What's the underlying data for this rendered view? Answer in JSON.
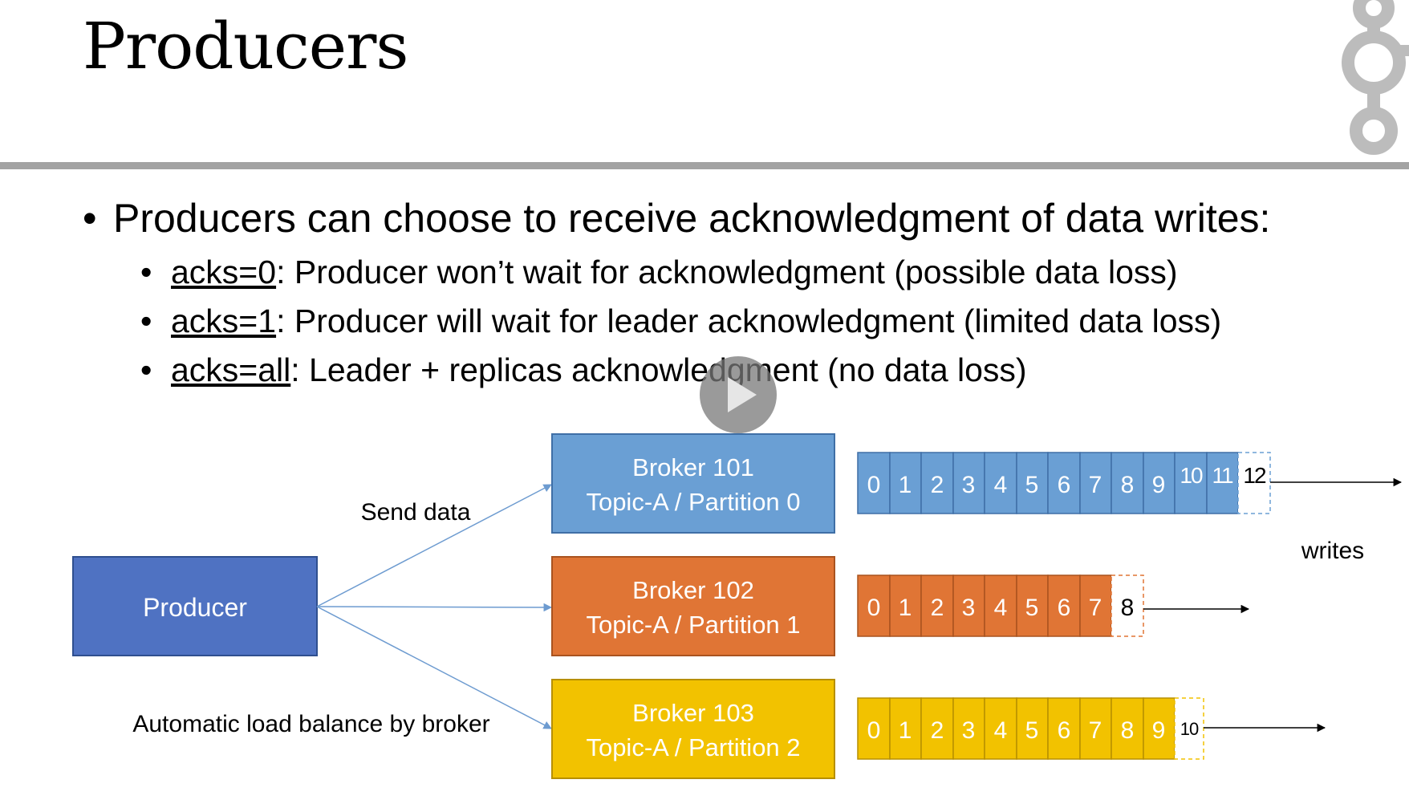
{
  "slide": {
    "title": "Producers",
    "bullet_main": "Producers can choose to receive acknowledgment of data writes:",
    "sub_bullets": [
      {
        "key": "acks=0",
        "text": ": Producer won’t wait for acknowledgment (possible data loss)"
      },
      {
        "key": "acks=1",
        "text": ": Producer will wait for leader acknowledgment (limited data loss)"
      },
      {
        "key": "acks=all",
        "text": ": Leader + replicas acknowledgment (no data loss)"
      }
    ]
  },
  "diagram": {
    "producer_label": "Producer",
    "send_data_label": "Send data",
    "load_balance_label": "Automatic load balance by broker",
    "writes_label": "writes",
    "brokers": [
      {
        "line1": "Broker 101",
        "line2": "Topic-A / Partition 0",
        "color": "#6a9fd4",
        "cells": [
          "0",
          "1",
          "2",
          "3",
          "4",
          "5",
          "6",
          "7",
          "8",
          "9",
          "10",
          "11"
        ],
        "next": "12"
      },
      {
        "line1": "Broker 102",
        "line2": "Topic-A / Partition 1",
        "color": "#e07535",
        "cells": [
          "0",
          "1",
          "2",
          "3",
          "4",
          "5",
          "6",
          "7"
        ],
        "next": "8"
      },
      {
        "line1": "Broker 103",
        "line2": "Topic-A / Partition 2",
        "color": "#f2c200",
        "cells": [
          "0",
          "1",
          "2",
          "3",
          "4",
          "5",
          "6",
          "7",
          "8",
          "9"
        ],
        "next": "10"
      }
    ],
    "producer_color": "#4f72c2",
    "arrow_color": "#6d9bd0"
  }
}
